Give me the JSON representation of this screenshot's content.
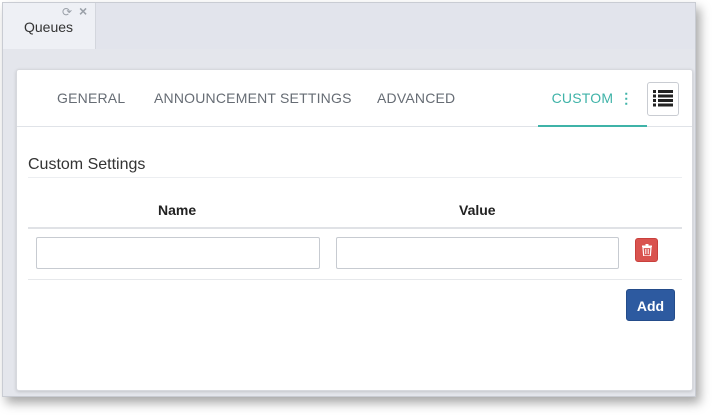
{
  "doc_tab": {
    "label": "Queues",
    "refresh_glyph": "⟳",
    "close_glyph": "×"
  },
  "tabs": [
    {
      "label": "GENERAL",
      "active": false
    },
    {
      "label": "ANNOUNCEMENT SETTINGS",
      "active": false
    },
    {
      "label": "ADVANCED",
      "active": false
    },
    {
      "label": "CUSTOM",
      "active": true
    }
  ],
  "tab_menu_glyph": "⋮",
  "section": {
    "title": "Custom Settings"
  },
  "table": {
    "columns": [
      "Name",
      "Value"
    ],
    "rows": [
      {
        "name": "",
        "value": ""
      }
    ]
  },
  "add_label": "Add",
  "icons": {
    "list": "list-icon",
    "trash": "trash-icon",
    "refresh": "refresh-icon",
    "close": "close-icon",
    "kebab": "kebab-menu-icon"
  },
  "colors": {
    "accent": "#3fb3a8",
    "primary": "#2d5aa0",
    "danger": "#d9534f"
  }
}
